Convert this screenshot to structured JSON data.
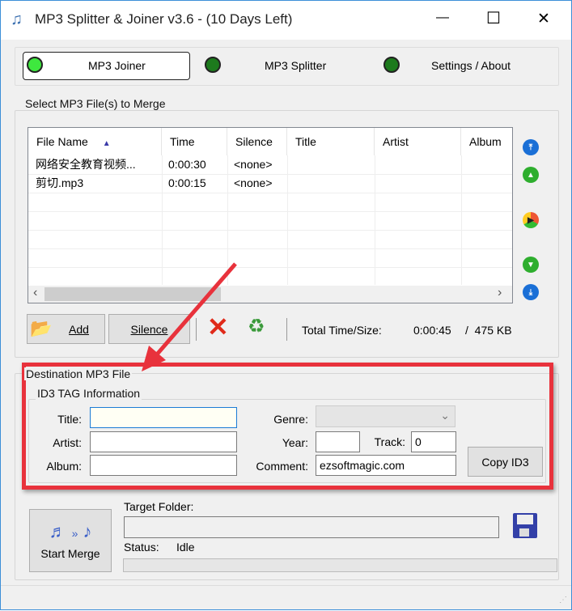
{
  "window": {
    "title": "MP3 Splitter & Joiner v3.6 - (10 Days Left)",
    "minimize": "—",
    "maximize": "☐",
    "close": "✕"
  },
  "tabs": [
    {
      "label": "MP3 Joiner",
      "active": true
    },
    {
      "label": "MP3 Splitter"
    },
    {
      "label": "Settings / About"
    }
  ],
  "select_group": {
    "label": "Select MP3 File(s) to Merge",
    "columns": [
      "File Name",
      "Time",
      "Silence",
      "Title",
      "Artist",
      "Album"
    ],
    "sort_indicator": "▲",
    "rows": [
      {
        "file": "网络安全教育视频...",
        "time": "0:00:30",
        "silence": "<none>"
      },
      {
        "file": "剪切.mp3",
        "time": "0:00:15",
        "silence": "<none>"
      }
    ],
    "scroll_left": "‹",
    "scroll_right": "›"
  },
  "toolbar": {
    "add": "Add",
    "silence": "Silence",
    "total_label": "Total Time/Size:",
    "total_time": "0:00:45",
    "total_size": "/  475 KB"
  },
  "destination": {
    "label": "Destination MP3 File",
    "id3_label": "ID3 TAG Information",
    "title_label": "Title:",
    "artist_label": "Artist:",
    "album_label": "Album:",
    "genre_label": "Genre:",
    "year_label": "Year:",
    "track_label": "Track:",
    "comment_label": "Comment:",
    "title": "",
    "artist": "",
    "album": "",
    "genre": "",
    "year": "",
    "track": "0",
    "comment": "ezsoftmagic.com",
    "copy_id3": "Copy ID3"
  },
  "bottom": {
    "start_merge": "Start Merge",
    "target_folder_label": "Target Folder:",
    "target_folder": "",
    "status_label": "Status:",
    "status": "Idle"
  },
  "colors": {
    "annotation": "#e8323c",
    "led_active": "#3ee83e",
    "led_inactive": "#1d7a1d"
  }
}
